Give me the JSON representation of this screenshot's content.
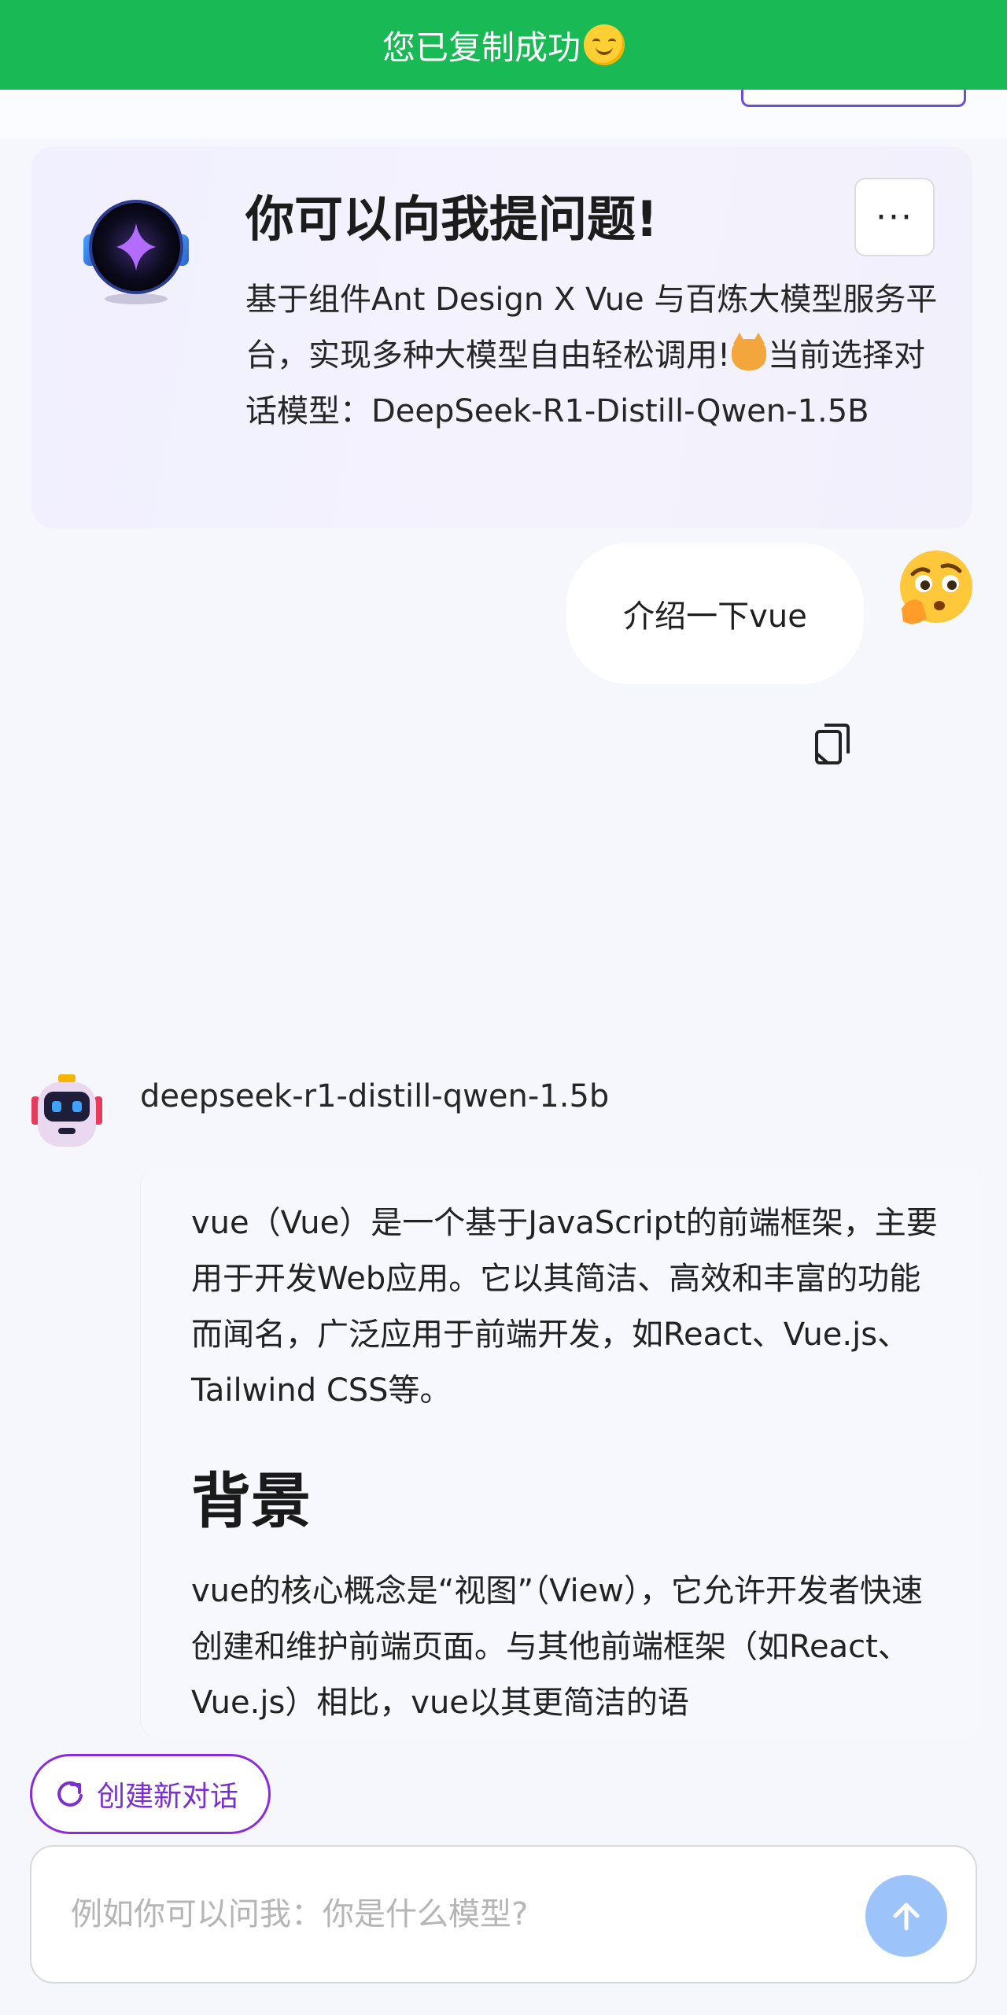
{
  "toast": {
    "text": "您已复制成功",
    "icon": "smile-emoji-icon"
  },
  "welcome": {
    "title": "你可以向我提问题!",
    "description_part1": "基于组件Ant Design X Vue 与百炼大模型服务平台，实现多种大模型自由轻松调用!",
    "description_part2": "当前选择对话模型：DeepSeek-R1-Distill-Qwen-1.5B",
    "more_label": "···"
  },
  "user_message": {
    "text": "介绍一下vue",
    "avatar_icon": "thinking-face-icon"
  },
  "assistant": {
    "name": "deepseek-r1-distill-qwen-1.5b",
    "avatar_icon": "robot-icon",
    "paragraph1": "vue（Vue）是一个基于JavaScript的前端框架，主要用于开发Web应用。它以其简洁、高效和丰富的功能而闻名，广泛应用于前端开发，如React、Vue.js、Tailwind CSS等。",
    "heading": "背景",
    "paragraph2": "vue的核心概念是“视图”（View），它允许开发者快速创建和维护前端页面。与其他前端框架（如React、Vue.js）相比，vue以其更简洁的语"
  },
  "footer": {
    "new_chat_label": "创建新对话",
    "input_placeholder": "例如你可以问我：你是什么模型?",
    "input_value": ""
  },
  "colors": {
    "toast_bg": "#19b955",
    "accent_purple": "#8a2be2",
    "send_button": "#9cc4fb",
    "page_bg": "#f5f7fc"
  }
}
